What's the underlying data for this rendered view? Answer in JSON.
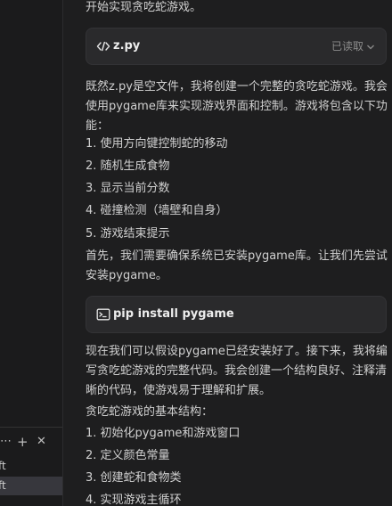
{
  "side_panel": {
    "controls": [
      "⋯",
      "+",
      "✕"
    ],
    "items": [
      {
        "label": "ft",
        "selected": false
      },
      {
        "label": "ft",
        "selected": true
      }
    ]
  },
  "chat": {
    "intro_line": "开始实现贪吃蛇游戏。",
    "file_card": {
      "title": "z.py",
      "status": "已读取",
      "icon": "code-icon"
    },
    "para1": "既然z.py是空文件，我将创建一个完整的贪吃蛇游戏。我会使用pygame库来实现游戏界面和控制。游戏将包含以下功能：",
    "features": [
      "1. 使用方向键控制蛇的移动",
      "2. 随机生成食物",
      "3. 显示当前分数",
      "4. 碰撞检测（墙壁和自身）",
      "5. 游戏结束提示"
    ],
    "para2": "首先，我们需要确保系统已安装pygame库。让我们先尝试安装pygame。",
    "command_card": {
      "title": "pip install pygame",
      "icon": "terminal-icon"
    },
    "para3": "现在我们可以假设pygame已经安装好了。接下来，我将编写贪吃蛇游戏的完整代码。我会创建一个结构良好、注释清晰的代码，使游戏易于理解和扩展。",
    "structure_title": "贪吃蛇游戏的基本结构：",
    "structure": [
      "1. 初始化pygame和游戏窗口",
      "2. 定义颜色常量",
      "3. 创建蛇和食物类",
      "4. 实现游戏主循环"
    ]
  }
}
